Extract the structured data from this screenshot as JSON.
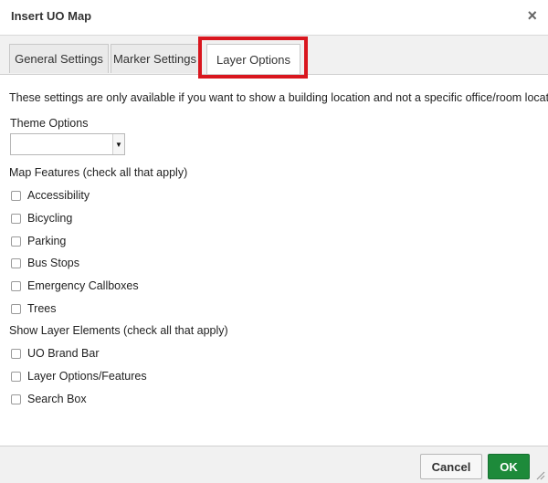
{
  "dialog": {
    "title": "Insert UO Map",
    "close_icon": "×"
  },
  "tabs": [
    {
      "label": "General Settings"
    },
    {
      "label": "Marker Settings"
    },
    {
      "label": "Layer Options",
      "active": true
    }
  ],
  "highlight_color": "#d9161e",
  "content": {
    "description": "These settings are only available if you want to show a building location and not a specific office/room location.",
    "theme_label": "Theme Options",
    "theme_value": "",
    "map_features_label": "Map Features (check all that apply)",
    "map_features": [
      {
        "label": "Accessibility",
        "checked": false
      },
      {
        "label": "Bicycling",
        "checked": false
      },
      {
        "label": "Parking",
        "checked": false
      },
      {
        "label": "Bus Stops",
        "checked": false
      },
      {
        "label": "Emergency Callboxes",
        "checked": false
      },
      {
        "label": "Trees",
        "checked": false
      }
    ],
    "layer_elements_label": "Show Layer Elements (check all that apply)",
    "layer_elements": [
      {
        "label": "UO Brand Bar",
        "checked": false
      },
      {
        "label": "Layer Options/Features",
        "checked": false
      },
      {
        "label": "Search Box",
        "checked": false
      }
    ]
  },
  "footer": {
    "cancel_label": "Cancel",
    "ok_label": "OK",
    "ok_color": "#1d8a3a"
  }
}
